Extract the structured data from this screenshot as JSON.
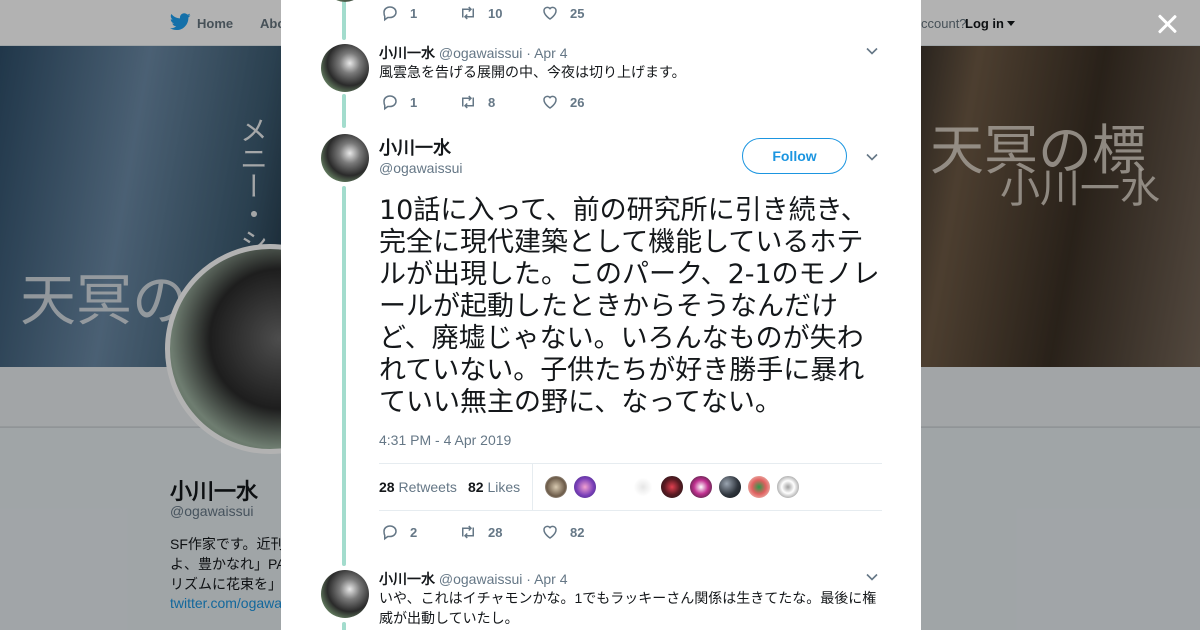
{
  "nav": {
    "home": "Home",
    "about": "Abo",
    "account": "ccount?",
    "login": "Log in"
  },
  "banner": {
    "left_title": "天冥の",
    "left_vertical": "メニー・シープ",
    "right_title": "天冥の標",
    "right_author": "小川一水"
  },
  "profile": {
    "name": "小川一水",
    "handle": "@ogawaissui",
    "bio": "SF作家です。近刊\nよ、豊かなれ」PA\nリズムに花束を」",
    "link": "twitter.com/ogawa"
  },
  "modal": {
    "top_actions": {
      "reply": "1",
      "retweet": "10",
      "like": "25"
    },
    "tweet1": {
      "name": "小川一水",
      "handle": "@ogawaissui",
      "dot": "·",
      "date": "Apr 4",
      "text": "風雲急を告げる展開の中、今夜は切り上げます。",
      "reply": "1",
      "retweet": "8",
      "like": "26"
    },
    "main": {
      "name": "小川一水",
      "handle": "@ogawaissui",
      "follow": "Follow",
      "text": "10話に入って、前の研究所に引き続き、完全に現代建築として機能しているホテルが出現した。このパーク、2-1のモノレールが起動したときからそうなんだけど、廃墟じゃない。いろんなものが失われていない。子供たちが好き勝手に暴れていい無主の野に、なってない。",
      "time": "4:31 PM - 4 Apr 2019",
      "retweets_count": "28",
      "retweets_label": "Retweets",
      "likes_count": "82",
      "likes_label": "Likes",
      "reply": "2",
      "retweet": "28",
      "like": "82"
    },
    "tweet3": {
      "name": "小川一水",
      "handle": "@ogawaissui",
      "dot": "·",
      "date": "Apr 4",
      "text": "いや、これはイチャモンかな。1でもラッキーさん関係は生きてたな。最後に権威が出動していたし。"
    }
  },
  "colors": {
    "accent": "#1b95e0",
    "thread": "#a3dccd",
    "muted": "#657786",
    "text": "#14171a"
  },
  "icons": [
    "twitter-bird-icon",
    "close-icon",
    "reply-icon",
    "retweet-icon",
    "heart-icon",
    "chevron-down-icon"
  ]
}
